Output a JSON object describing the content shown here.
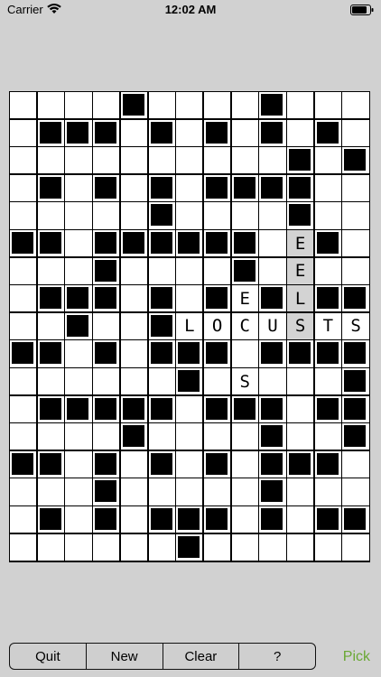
{
  "status_bar": {
    "carrier": "Carrier",
    "time": "12:02 AM"
  },
  "grid": {
    "rows": 17,
    "cols": 13,
    "row_masks": [
      "....#....#...",
      ".###.#.#.#.#.",
      "..........#.#",
      ".#.#.#.####..",
      ".....#....#..",
      "##.######.E#.",
      "...#....#.E..",
      ".###.#.#E#L##",
      "..#..#LOCUSTS",
      "##.#.###.####",
      "......#.S...#",
      ".#####.###.##",
      "....#....#..#",
      "##.#.#.#.###.",
      "...#.....#...",
      ".#.#.###.#.##",
      "......#......#"
    ],
    "highlighted": [
      "5,10",
      "6,10",
      "7,10",
      "8,10"
    ]
  },
  "toolbar": {
    "buttons": [
      "Quit",
      "New",
      "Clear",
      "?"
    ],
    "pick_label": "Pick",
    "pick_color": "#6aa834"
  }
}
